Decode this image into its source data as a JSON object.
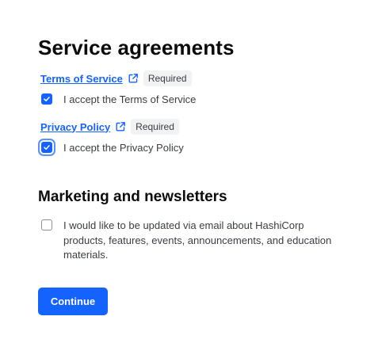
{
  "page": {
    "title": "Service agreements"
  },
  "agreements": [
    {
      "link_label": "Terms of Service",
      "badge": "Required",
      "checkbox_label": "I accept the Terms of Service",
      "checked": true
    },
    {
      "link_label": "Privacy Policy",
      "badge": "Required",
      "checkbox_label": "I accept the Privacy Policy",
      "checked": true
    }
  ],
  "marketing": {
    "title": "Marketing and newsletters",
    "checkbox_label": "I would like to be updated via email about HashiCorp products, features, events, announcements, and education materials.",
    "checked": false
  },
  "actions": {
    "continue_label": "Continue"
  },
  "icons": {
    "external_link": "external-link-icon",
    "checkmark": "checkmark-icon"
  },
  "colors": {
    "accent": "#1563ff",
    "badge_bg": "#f1f2f3",
    "focus_ring": "#5990ff"
  }
}
